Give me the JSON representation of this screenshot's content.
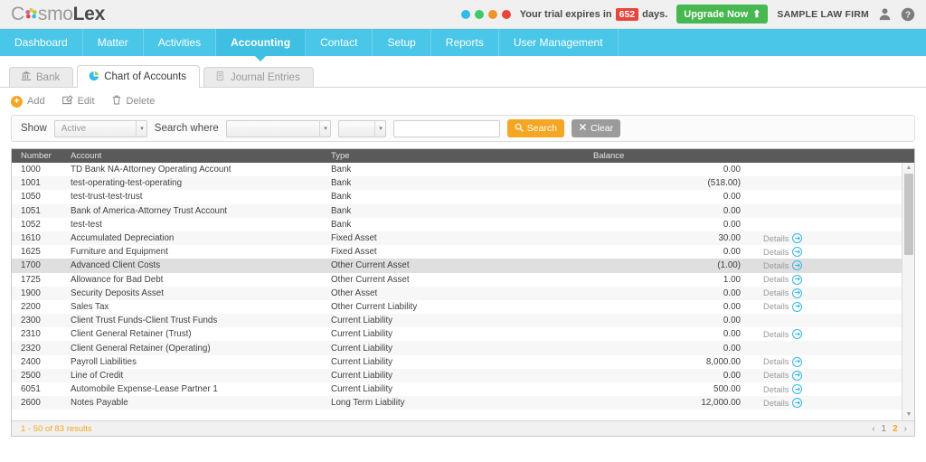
{
  "header": {
    "logo_cosmo": "C",
    "logo_smo": "smo",
    "logo_lex": "Lex",
    "logo_icon": "pinwheel-icon",
    "trial_prefix": "Your trial expires in",
    "trial_days": "652",
    "trial_suffix": "days.",
    "upgrade_label": "Upgrade Now",
    "upgrade_icon": "up-arrow-icon",
    "firm_name": "SAMPLE LAW FIRM",
    "user_icon": "user-icon",
    "help_icon": "help-icon",
    "dots": [
      "#35b9e6",
      "#3ec96b",
      "#f0932b",
      "#e8453c"
    ]
  },
  "mainnav": {
    "items": [
      {
        "label": "Dashboard",
        "active": false
      },
      {
        "label": "Matter",
        "active": false
      },
      {
        "label": "Activities",
        "active": false
      },
      {
        "label": "Accounting",
        "active": true
      },
      {
        "label": "Contact",
        "active": false
      },
      {
        "label": "Setup",
        "active": false
      },
      {
        "label": "Reports",
        "active": false
      },
      {
        "label": "User Management",
        "active": false
      }
    ]
  },
  "subtabs": [
    {
      "label": "Bank",
      "icon": "bank-icon",
      "active": false
    },
    {
      "label": "Chart of Accounts",
      "icon": "pie-chart-icon",
      "active": true
    },
    {
      "label": "Journal Entries",
      "icon": "journal-icon",
      "active": false
    }
  ],
  "toolbar": {
    "add_label": "Add",
    "edit_label": "Edit",
    "delete_label": "Delete"
  },
  "filter": {
    "show_label": "Show",
    "show_value": "Active",
    "search_where_label": "Search where",
    "field_value": "",
    "operator_value": "",
    "text_value": "",
    "search_label": "Search",
    "clear_label": "Clear",
    "search_icon": "magnifier-icon",
    "clear_icon": "x-icon"
  },
  "table": {
    "columns": [
      "Number",
      "Account",
      "Type",
      "Balance"
    ],
    "details_label": "Details",
    "rows": [
      {
        "number": "1000",
        "account": "TD Bank NA-Attorney Operating Account",
        "type": "Bank",
        "balance": "0.00",
        "details": false
      },
      {
        "number": "1001",
        "account": "test-operating-test-operating",
        "type": "Bank",
        "balance": "(518.00)",
        "details": false
      },
      {
        "number": "1050",
        "account": "test-trust-test-trust",
        "type": "Bank",
        "balance": "0.00",
        "details": false
      },
      {
        "number": "1051",
        "account": "Bank of America-Attorney Trust Account",
        "type": "Bank",
        "balance": "0.00",
        "details": false
      },
      {
        "number": "1052",
        "account": "test-test",
        "type": "Bank",
        "balance": "0.00",
        "details": false
      },
      {
        "number": "1610",
        "account": "Accumulated Depreciation",
        "type": "Fixed Asset",
        "balance": "30.00",
        "details": true
      },
      {
        "number": "1625",
        "account": "Furniture and Equipment",
        "type": "Fixed Asset",
        "balance": "0.00",
        "details": true
      },
      {
        "number": "1700",
        "account": "Advanced Client Costs",
        "type": "Other Current Asset",
        "balance": "(1.00)",
        "details": true,
        "hover": true
      },
      {
        "number": "1725",
        "account": "Allowance for Bad Debt",
        "type": "Other Current Asset",
        "balance": "1.00",
        "details": true
      },
      {
        "number": "1900",
        "account": "Security Deposits Asset",
        "type": "Other Asset",
        "balance": "0.00",
        "details": true
      },
      {
        "number": "2200",
        "account": "Sales Tax",
        "type": "Other Current Liability",
        "balance": "0.00",
        "details": true
      },
      {
        "number": "2300",
        "account": "Client Trust Funds-Client Trust Funds",
        "type": "Current Liability",
        "balance": "0.00",
        "details": false
      },
      {
        "number": "2310",
        "account": "Client General Retainer (Trust)",
        "type": "Current Liability",
        "balance": "0.00",
        "details": true
      },
      {
        "number": "2320",
        "account": "Client General Retainer (Operating)",
        "type": "Current Liability",
        "balance": "0.00",
        "details": false
      },
      {
        "number": "2400",
        "account": "Payroll Liabilities",
        "type": "Current Liability",
        "balance": "8,000.00",
        "details": true
      },
      {
        "number": "2500",
        "account": "Line of Credit",
        "type": "Current Liability",
        "balance": "0.00",
        "details": true
      },
      {
        "number": "6051",
        "account": "Automobile Expense-Lease Partner 1",
        "type": "Current Liability",
        "balance": "500.00",
        "details": true
      },
      {
        "number": "2600",
        "account": "Notes Payable",
        "type": "Long Term Liability",
        "balance": "12,000.00",
        "details": true
      }
    ]
  },
  "footer": {
    "results": "1 - 50 of 83 results",
    "prev": "‹",
    "next": "›",
    "pages": [
      {
        "label": "1",
        "active": false
      },
      {
        "label": "2",
        "active": true
      }
    ]
  }
}
